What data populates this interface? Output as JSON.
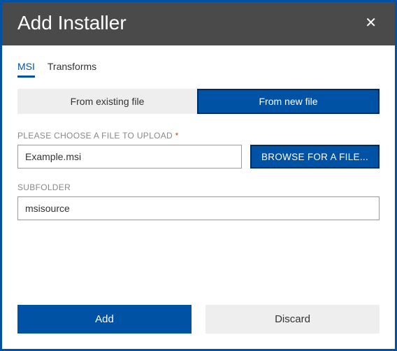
{
  "header": {
    "title": "Add Installer"
  },
  "tabs": {
    "msi": "MSI",
    "transforms": "Transforms"
  },
  "source": {
    "existing": "From existing file",
    "newfile": "From new file"
  },
  "upload": {
    "label": "PLEASE CHOOSE A FILE TO UPLOAD",
    "required": "*",
    "value": "Example.msi",
    "browse": "BROWSE FOR A FILE..."
  },
  "subfolder": {
    "label": "SUBFOLDER",
    "value": "msisource"
  },
  "footer": {
    "add": "Add",
    "discard": "Discard"
  }
}
